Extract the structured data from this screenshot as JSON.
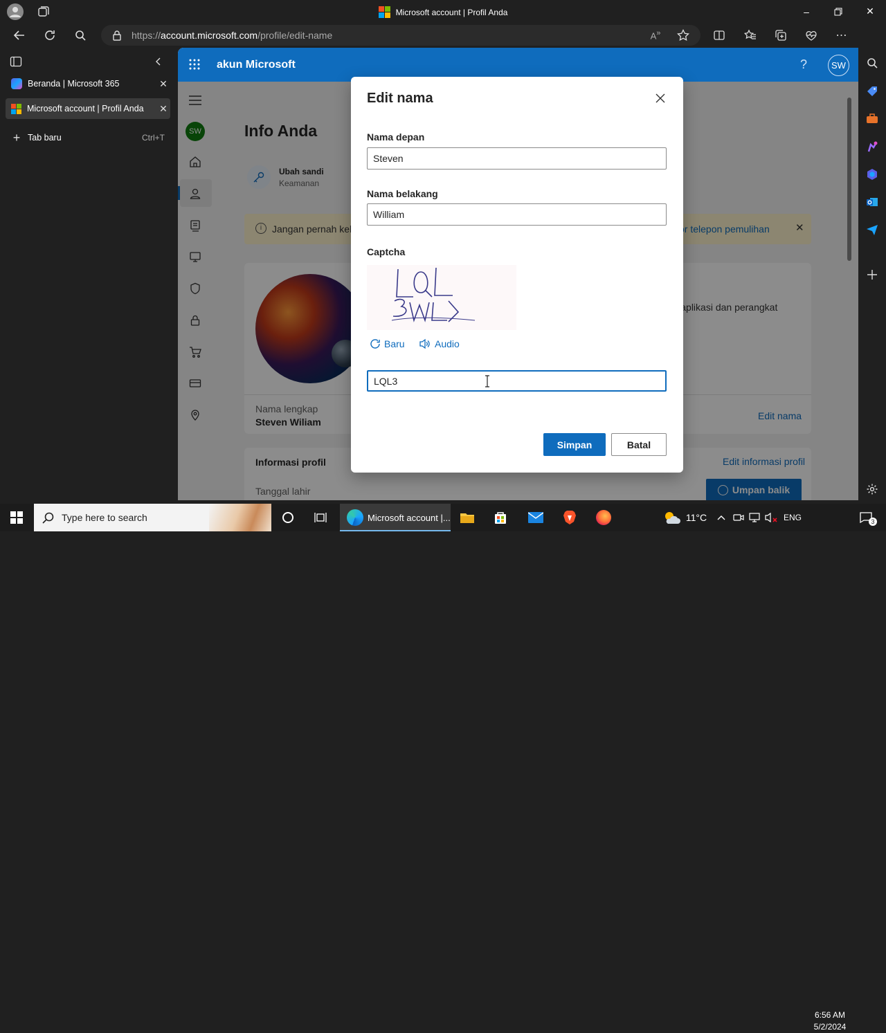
{
  "window": {
    "title": "Microsoft account | Profil Anda"
  },
  "address": {
    "prefix": "https://",
    "host": "account.microsoft.com",
    "path": "/profile/edit-name"
  },
  "sidebar_tabs": [
    {
      "label": "Beranda | Microsoft 365"
    },
    {
      "label": "Microsoft account | Profil Anda"
    },
    {
      "label": "Tab baru",
      "shortcut": "Ctrl+T"
    }
  ],
  "ms_header": {
    "app_name": "akun Microsoft",
    "help": "?",
    "avatar": "SW"
  },
  "page": {
    "title": "Info Anda",
    "avatar": "SW",
    "security_item": {
      "title": "Ubah sandi",
      "subtitle": "Keamanan"
    },
    "banner_left": "Jangan pernah keh",
    "banner_right": "or telepon pemulihan",
    "card_text": "ada aplikasi dan perangkat",
    "fullname_label": "Nama lengkap",
    "fullname_value": "Steven Wiliam",
    "edit_name_link": "Edit nama",
    "profile_info_label": "Informasi profil",
    "edit_profile_link": "Edit informasi profil",
    "birthdate_label": "Tanggal lahir",
    "feedback_button": "Umpan balik"
  },
  "dialog": {
    "title": "Edit nama",
    "first_name_label": "Nama depan",
    "first_name_value": "Steven",
    "last_name_label": "Nama belakang",
    "last_name_value": "William",
    "captcha_label": "Captcha",
    "captcha_image_text": "LQL 3WL",
    "refresh_label": "Baru",
    "audio_label": "Audio",
    "captcha_value": "LQL3",
    "save_button": "Simpan",
    "cancel_button": "Batal"
  },
  "taskbar": {
    "search_placeholder": "Type here to search",
    "active_app": "Microsoft account |...",
    "weather": "11°C",
    "language": "ENG",
    "time": "6:56 AM",
    "date": "5/2/2024",
    "notifications": "3"
  },
  "colors": {
    "accent": "#0f6cbd",
    "link": "#0f6cbd",
    "banner": "#fff4ce"
  }
}
